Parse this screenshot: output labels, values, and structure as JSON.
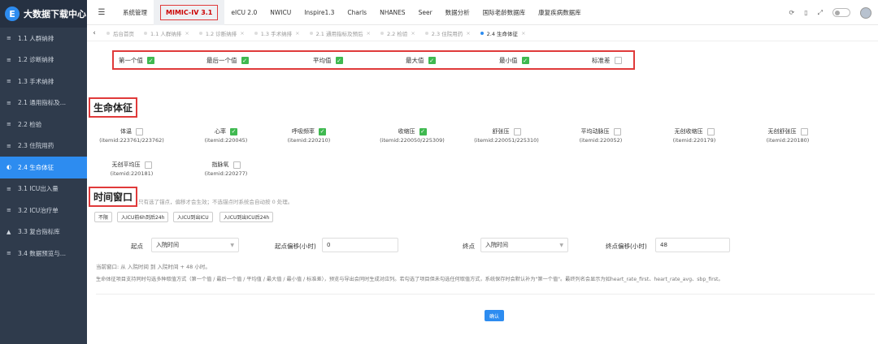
{
  "app": {
    "title": "大数据下载中心",
    "logo_letter": "E"
  },
  "sidebar": {
    "items": [
      {
        "icon": "≡",
        "label": "1.1 人群纳排"
      },
      {
        "icon": "≡",
        "label": "1.2 诊断纳排"
      },
      {
        "icon": "≡",
        "label": "1.3 手术纳排"
      },
      {
        "icon": "≡",
        "label": "2.1 通用指标及..."
      },
      {
        "icon": "≡",
        "label": "2.2 检验"
      },
      {
        "icon": "≡",
        "label": "2.3 住院用药"
      },
      {
        "icon": "◐",
        "label": "2.4 生命体征"
      },
      {
        "icon": "≡",
        "label": "3.1 ICU出入量"
      },
      {
        "icon": "≡",
        "label": "3.2 ICU治疗单"
      },
      {
        "icon": "▲",
        "label": "3.3 复合指标库"
      },
      {
        "icon": "≡",
        "label": "3.4 数据预览与..."
      }
    ]
  },
  "topnav": {
    "menu_icon": "☰",
    "tabs": [
      "系统管理",
      "MIMIC-IV 3.1",
      "eICU 2.0",
      "NWICU",
      "Inspire1.3",
      "Charls",
      "NHANES",
      "Seer",
      "数据分析",
      "国际老龄数据库",
      "康复疾病数据库"
    ],
    "right_icons": [
      "⟳",
      "▯",
      "⤢"
    ]
  },
  "tabstrip": {
    "prev_icon": "‹",
    "tabs": [
      {
        "label": "后台首页",
        "closable": false
      },
      {
        "label": "1.1 人群纳排",
        "closable": true
      },
      {
        "label": "1.2 诊断纳排",
        "closable": true
      },
      {
        "label": "1.3 手术纳排",
        "closable": true
      },
      {
        "label": "2.1 通用指标及预后",
        "closable": true
      },
      {
        "label": "2.2 检验",
        "closable": true
      },
      {
        "label": "2.3 住院用药",
        "closable": true
      },
      {
        "label": "2.4 生命体征",
        "closable": true
      }
    ],
    "close_glyph": "×"
  },
  "aggregations": [
    {
      "label": "第一个值",
      "checked": true
    },
    {
      "label": "最后一个值",
      "checked": true
    },
    {
      "label": "平均值",
      "checked": true
    },
    {
      "label": "最大值",
      "checked": true
    },
    {
      "label": "最小值",
      "checked": true
    },
    {
      "label": "标准差",
      "checked": false
    }
  ],
  "vitals_section": {
    "title": "生命体征",
    "items": [
      {
        "label": "体温",
        "itemid": "(itemid:223761/223762)",
        "checked": false
      },
      {
        "label": "心率",
        "itemid": "(itemid:220045)",
        "checked": true
      },
      {
        "label": "呼吸频率",
        "itemid": "(itemid:220210)",
        "checked": true
      },
      {
        "label": "收缩压",
        "itemid": "(itemid:220050/225309)",
        "checked": true
      },
      {
        "label": "舒张压",
        "itemid": "(itemid:220051/225310)",
        "checked": false
      },
      {
        "label": "平均动脉压",
        "itemid": "(itemid:220052)",
        "checked": false
      },
      {
        "label": "无创收缩压",
        "itemid": "(itemid:220179)",
        "checked": false
      },
      {
        "label": "无创舒张压",
        "itemid": "(itemid:220180)",
        "checked": false
      },
      {
        "label": "无创平均压",
        "itemid": "(itemid:220181)",
        "checked": false
      },
      {
        "label": "指脉氧",
        "itemid": "(itemid:220277)",
        "checked": false
      }
    ]
  },
  "time_window": {
    "title": "时间窗口",
    "hint": "只有选了锚点，偏移才会生效；不选锚点时系统会自动按 0 处理。",
    "quick_buttons": [
      "不限",
      "入ICU前6h到后24h",
      "入ICU到出ICU",
      "入ICU到出ICU后24h"
    ],
    "start_label": "起点",
    "start_value": "入院时间",
    "start_offset_label": "起点偏移(小时)",
    "start_offset_value": "0",
    "end_label": "终点",
    "end_value": "入院时间",
    "end_offset_label": "终点偏移(小时)",
    "end_offset_value": "48",
    "current_window": "当前窗口: 从 入院时间 到 入院时间 + 48 小时。",
    "description": "生命体征项目支持同时勾选多种取值方式（第一个值 / 最后一个值 / 平均值 / 最大值 / 最小值 / 标准差），预览与导出会同时生成对应列。若勾选了项目但未勾选任何取值方式，系统保存时会默认补为\"第一个值\"。最终列名会显示为如heart_rate_first、heart_rate_avg、sbp_first。"
  },
  "confirm_label": "确认"
}
